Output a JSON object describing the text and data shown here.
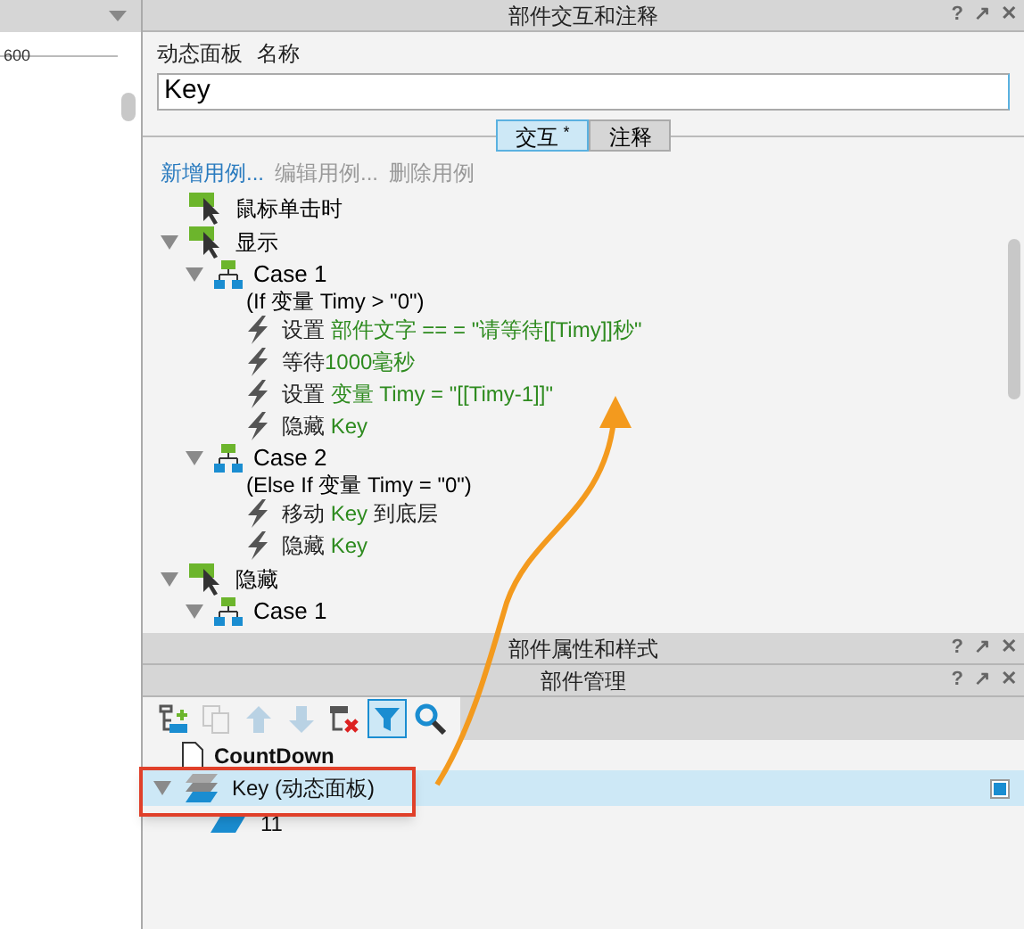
{
  "canvas": {
    "ruler_label": "600"
  },
  "interaction_panel": {
    "title": "部件交互和注释",
    "controls": [
      "?",
      "↗",
      "✕"
    ],
    "widget_type": "动态面板",
    "name_label": "名称",
    "name_value": "Key",
    "tabs": [
      {
        "label": "交互",
        "marker": "*",
        "selected": true
      },
      {
        "label": "注释",
        "selected": false
      }
    ],
    "links": [
      {
        "label": "新增用例...",
        "disabled": false
      },
      {
        "label": "编辑用例...",
        "disabled": true
      },
      {
        "label": "删除用例",
        "disabled": true
      }
    ],
    "events": [
      {
        "label": "鼠标单击时"
      },
      {
        "label": "显示",
        "expanded": true,
        "children": [
          {
            "label": "Case 1",
            "condition": "(If 变量 Timy > \"0\")",
            "expanded": true,
            "children": [
              {
                "parts": [
                  {
                    "kind": "plain",
                    "text": "设置"
                  },
                  {
                    "kind": "value",
                    "text": "部件文字 == = \"请等待[[Timy]]秒\""
                  }
                ]
              },
              {
                "parts": [
                  {
                    "kind": "plain",
                    "text": "等待"
                  },
                  {
                    "kind": "value",
                    "text": "1000毫秒",
                    "attached": true
                  }
                ]
              },
              {
                "parts": [
                  {
                    "kind": "plain",
                    "text": "设置"
                  },
                  {
                    "kind": "value",
                    "text": "变量 Timy = \"[[Timy-1]]\""
                  }
                ]
              },
              {
                "parts": [
                  {
                    "kind": "plain",
                    "text": "隐藏"
                  },
                  {
                    "kind": "value",
                    "text": "Key"
                  }
                ]
              }
            ]
          },
          {
            "label": "Case 2",
            "condition": "(Else If 变量 Timy = \"0\")",
            "expanded": true,
            "children": [
              {
                "parts": [
                  {
                    "kind": "plain",
                    "text": "移动"
                  },
                  {
                    "kind": "value",
                    "text": "Key"
                  },
                  {
                    "kind": "plain",
                    "text": "到底层"
                  }
                ]
              },
              {
                "parts": [
                  {
                    "kind": "plain",
                    "text": "隐藏"
                  },
                  {
                    "kind": "value",
                    "text": "Key"
                  }
                ]
              }
            ]
          }
        ]
      },
      {
        "label": "隐藏",
        "expanded": true,
        "children": [
          {
            "label": "Case 1",
            "expanded": true
          }
        ]
      }
    ]
  },
  "style_panel": {
    "title": "部件属性和样式",
    "controls": [
      "?",
      "↗",
      "✕"
    ]
  },
  "manager_panel": {
    "title": "部件管理",
    "controls": [
      "?",
      "↗",
      "✕"
    ],
    "toolbar": [
      {
        "kind": "add",
        "disabled": false,
        "selected": false
      },
      {
        "kind": "copy",
        "disabled": true,
        "selected": false
      },
      {
        "kind": "up",
        "disabled": true,
        "selected": false
      },
      {
        "kind": "down",
        "disabled": true,
        "selected": false
      },
      {
        "kind": "delete",
        "disabled": false,
        "selected": false
      },
      {
        "kind": "filter",
        "disabled": false,
        "selected": true
      },
      {
        "kind": "search",
        "disabled": false,
        "selected": false
      }
    ],
    "tree": [
      {
        "kind": "page",
        "label": "CountDown",
        "selected": false
      },
      {
        "kind": "panel",
        "label": "Key (动态面板)",
        "selected": true,
        "expanded": true,
        "children": [
          {
            "kind": "state",
            "label": "11",
            "selected": false
          }
        ]
      }
    ]
  }
}
